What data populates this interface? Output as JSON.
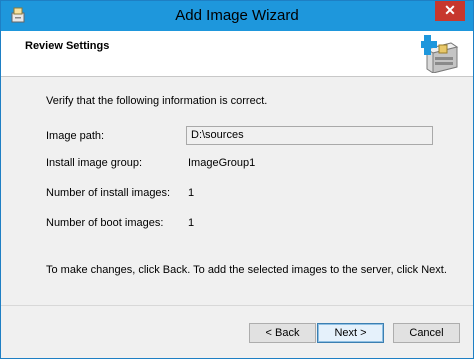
{
  "window": {
    "title": "Add Image Wizard",
    "close_label": "✕"
  },
  "header": {
    "title": "Review Settings"
  },
  "content": {
    "intro": "Verify that the following information is correct.",
    "fields": [
      {
        "label": "Image path:",
        "value": "D:\\sources"
      },
      {
        "label": "Install image group:",
        "value": "ImageGroup1"
      },
      {
        "label": "Number of install images:",
        "value": "1"
      },
      {
        "label": "Number of boot images:",
        "value": "1"
      }
    ],
    "footer_note": "To make changes, click Back. To add the selected images to the server, click Next."
  },
  "buttons": {
    "back": "< Back",
    "next": "Next >",
    "cancel": "Cancel"
  },
  "colors": {
    "titlebar": "#1e97dc",
    "close": "#c7372d"
  },
  "icons": {
    "title": "wizard-app-icon",
    "header": "server-add-image-icon"
  }
}
